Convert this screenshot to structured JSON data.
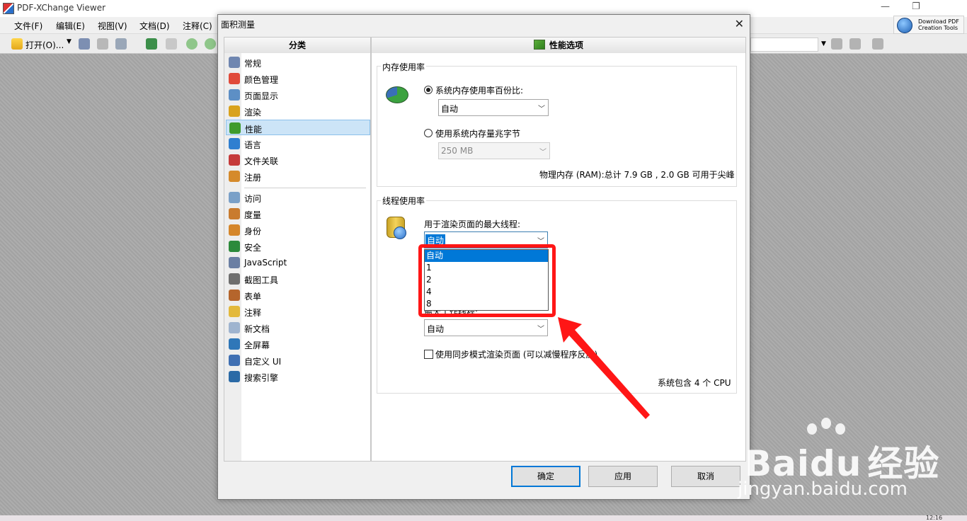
{
  "app": {
    "title": "PDF-XChange Viewer",
    "restore_glyph": "❐",
    "minimize_glyph": "—",
    "clock": "12:16"
  },
  "menu": [
    "文件(F)",
    "编辑(E)",
    "视图(V)",
    "文档(D)",
    "注释(C)"
  ],
  "toolbar": {
    "open_label": "打开(O)...",
    "download_line1": "Download PDF",
    "download_line2": "Creation Tools"
  },
  "dialog": {
    "title": "面积测量",
    "close_glyph": "✕",
    "category_header": "分类",
    "content_header": "性能选项",
    "categories": [
      {
        "label": "常规",
        "icon": "gears-icon",
        "color": "#6f86b0"
      },
      {
        "label": "颜色管理",
        "icon": "color-balls-icon",
        "color": "#e04a3a"
      },
      {
        "label": "页面显示",
        "icon": "page-magnifier-icon",
        "color": "#5d8fc5"
      },
      {
        "label": "渲染",
        "icon": "brush-icon",
        "color": "#d9a21c"
      },
      {
        "label": "性能",
        "icon": "performance-chart-icon",
        "color": "#3f9b2d"
      },
      {
        "label": "语言",
        "icon": "globe-icon",
        "color": "#2f7fd0"
      },
      {
        "label": "文件关联",
        "icon": "file-association-icon",
        "color": "#c53a3a"
      },
      {
        "label": "注册",
        "icon": "users-icon",
        "color": "#d58a2b"
      },
      {
        "label": "访问",
        "icon": "link-icon",
        "color": "#7aa0c8"
      },
      {
        "label": "度量",
        "icon": "ruler-icon",
        "color": "#c97b2e"
      },
      {
        "label": "身份",
        "icon": "identity-icon",
        "color": "#d5862a"
      },
      {
        "label": "安全",
        "icon": "shield-icon",
        "color": "#2c8a3b"
      },
      {
        "label": "JavaScript",
        "icon": "javascript-icon",
        "color": "#6b7fa3"
      },
      {
        "label": "截图工具",
        "icon": "camera-icon",
        "color": "#6e6e6e"
      },
      {
        "label": "表单",
        "icon": "form-icon",
        "color": "#b5652c"
      },
      {
        "label": "注释",
        "icon": "comment-icon",
        "color": "#e3b93c"
      },
      {
        "label": "新文档",
        "icon": "new-document-icon",
        "color": "#9fb4cf"
      },
      {
        "label": "全屏幕",
        "icon": "fullscreen-icon",
        "color": "#2f77b8"
      },
      {
        "label": "自定义 UI",
        "icon": "customize-ui-icon",
        "color": "#3f6fb2"
      },
      {
        "label": "搜索引擎",
        "icon": "search-engine-icon",
        "color": "#2b6aa6"
      }
    ],
    "memory": {
      "group_title": "内存使用率",
      "radio_percent_label": "系统内存使用率百份比:",
      "percent_value": "自动",
      "radio_mb_label": "使用系统内存量兆字节",
      "mb_value": "250 MB",
      "physical_info": "物理内存 (RAM):总计 7.9 GB , 2.0 GB 可用于尖峰"
    },
    "threads": {
      "group_title": "线程使用率",
      "render_threads_label": "用于渲染页面的最大线程:",
      "render_threads_value": "自动",
      "dropdown_options": [
        "自动",
        "1",
        "2",
        "4",
        "8"
      ],
      "worker_threads_label": "最大工作线程:",
      "worker_threads_value": "自动",
      "sync_mode_label": "使用同步模式渲染页面 (可以减慢程序反应)",
      "cpu_info": "系统包含 4 个 CPU"
    },
    "buttons": {
      "ok": "确定",
      "apply": "应用",
      "cancel": "取消"
    }
  },
  "watermark": {
    "brand": "Bai",
    "brand2": "du",
    "brand_cn": "经验",
    "url": "jingyan.baidu.com"
  },
  "colors": {
    "highlight": "#ff1616",
    "selection": "#0078d7",
    "category_selected": "#cce4f7"
  }
}
